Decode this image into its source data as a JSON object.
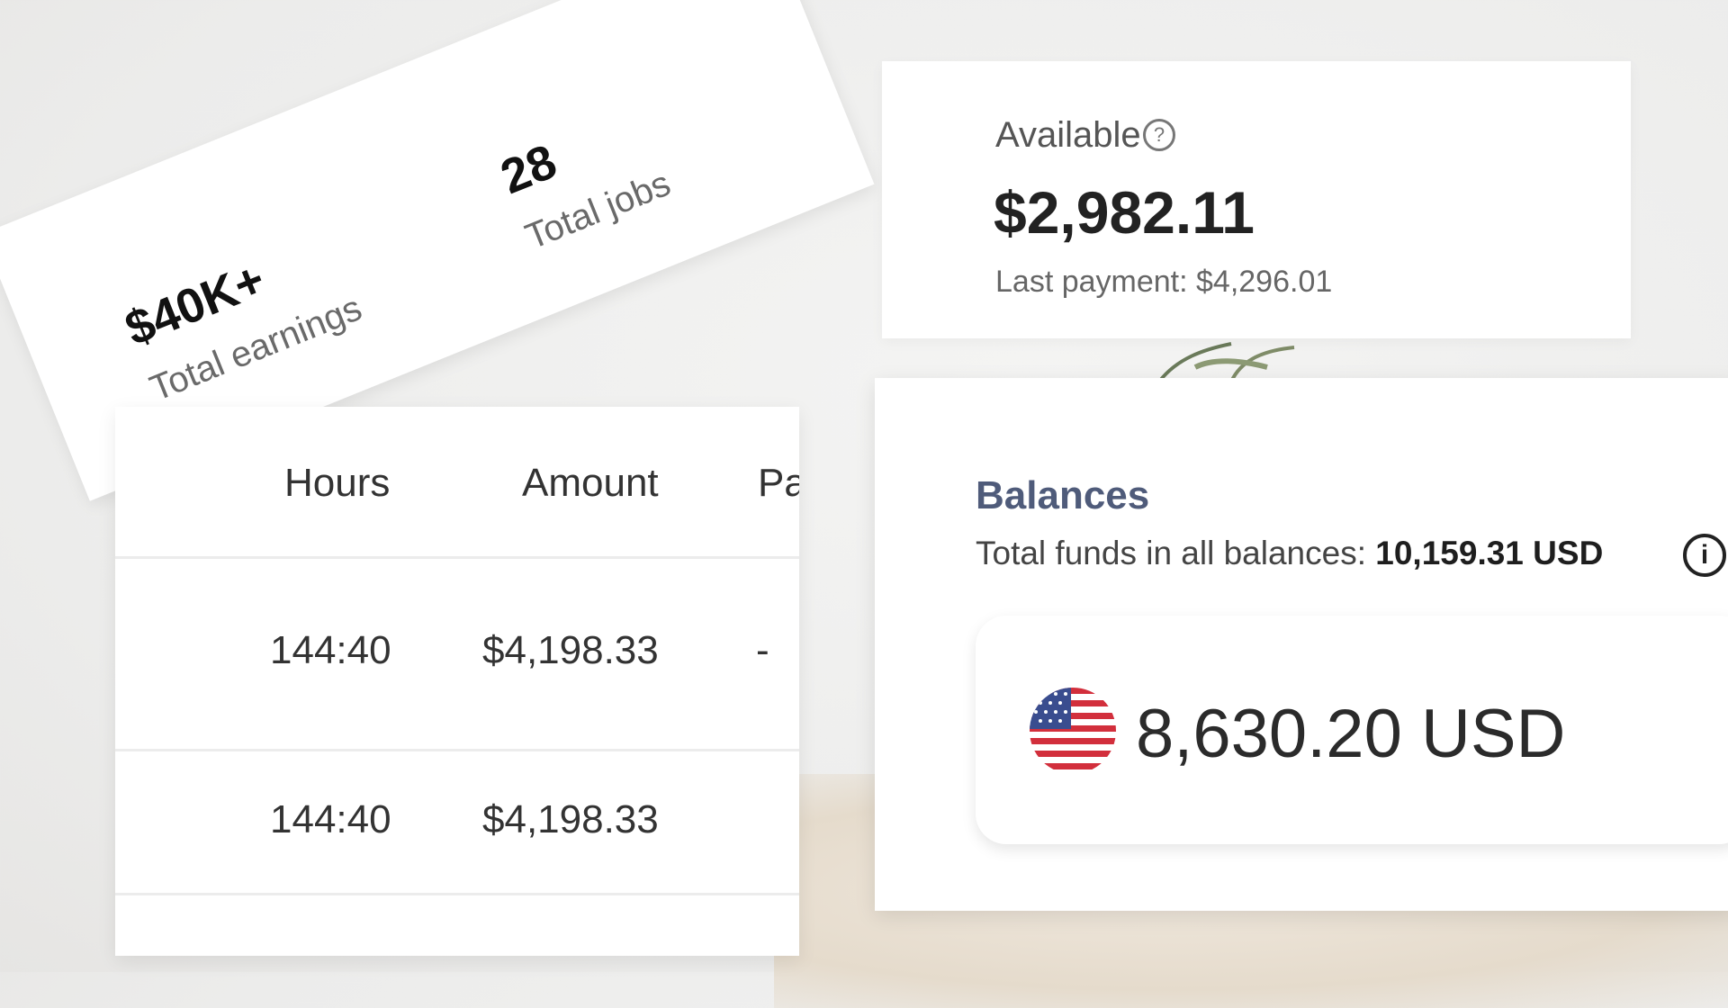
{
  "stats": {
    "earnings_value": "$40K+",
    "earnings_label": "Total earnings",
    "jobs_value": "28",
    "jobs_label": "Total jobs"
  },
  "available": {
    "label": "Available",
    "help_icon": "question-circle-icon",
    "amount": "$2,982.11",
    "last_payment": "Last payment: $4,296.01"
  },
  "table": {
    "headers": [
      "Hours",
      "Amount",
      "Pa"
    ],
    "rows": [
      {
        "hours": "144:40",
        "amount": "$4,198.33",
        "extra": "-"
      },
      {
        "hours": "144:40",
        "amount": "$4,198.33",
        "extra": ""
      }
    ]
  },
  "balances": {
    "title": "Balances",
    "total_label": "Total funds in all balances:",
    "total_value": "10,159.31 USD",
    "info_icon": "info-circle-icon",
    "account": {
      "flag": "us-flag-icon",
      "amount": "8,630.20 USD"
    }
  }
}
